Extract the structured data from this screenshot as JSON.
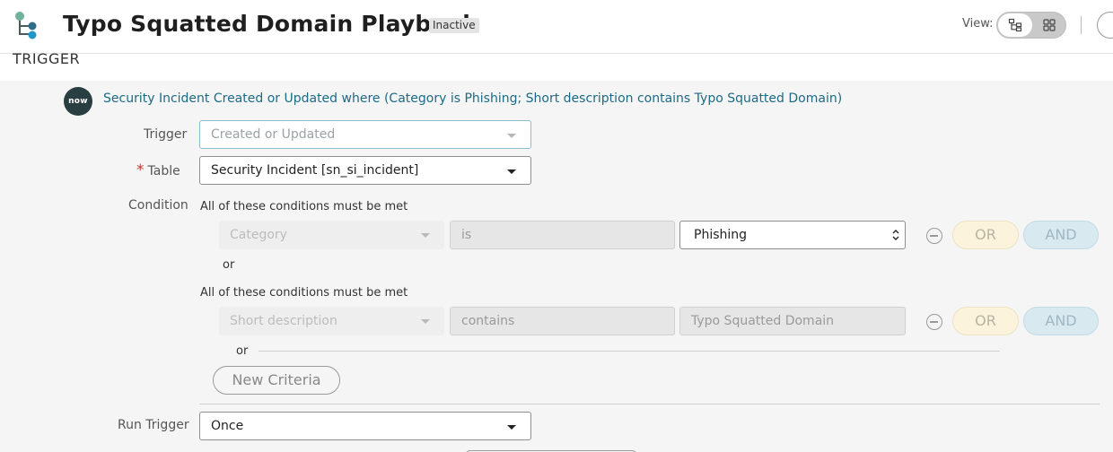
{
  "header": {
    "title": "Typo Squatted Domain Playbook",
    "status_badge": "Inactive",
    "view_label": "View:",
    "view_modes": [
      "tree-view-icon",
      "grid-view-icon"
    ],
    "logo_colors": [
      "#6fb19b",
      "#2f6e88",
      "#1f97c7"
    ]
  },
  "section": {
    "title": "TRIGGER"
  },
  "trigger_summary": {
    "badge": "now",
    "text": "Security Incident Created or Updated where (Category is Phishing; Short description contains Typo Squatted Domain)"
  },
  "form": {
    "trigger": {
      "label": "Trigger",
      "value": "Created or Updated"
    },
    "table": {
      "label": "Table",
      "required_mark": "*",
      "value": "Security Incident [sn_si_incident]"
    },
    "condition": {
      "label": "Condition",
      "groups": [
        {
          "heading": "All of these conditions must be met",
          "field": "Category",
          "operator": "is",
          "value": "Phishing",
          "or_label": "OR",
          "and_label": "AND"
        },
        {
          "heading": "All of these conditions must be met",
          "field": "Short description",
          "operator": "contains",
          "value": "Typo Squatted Domain",
          "or_label": "OR",
          "and_label": "AND"
        }
      ],
      "between_groups": "or",
      "after_groups": "or",
      "new_criteria_label": "New Criteria"
    },
    "run_trigger": {
      "label": "Run Trigger",
      "value": "Once"
    }
  },
  "colors": {
    "link": "#1c6a85",
    "required": "#c0392b",
    "panel_bg": "#f5f5f5",
    "or_bg": "#fbf3dc",
    "and_bg": "#d9e9f0"
  }
}
